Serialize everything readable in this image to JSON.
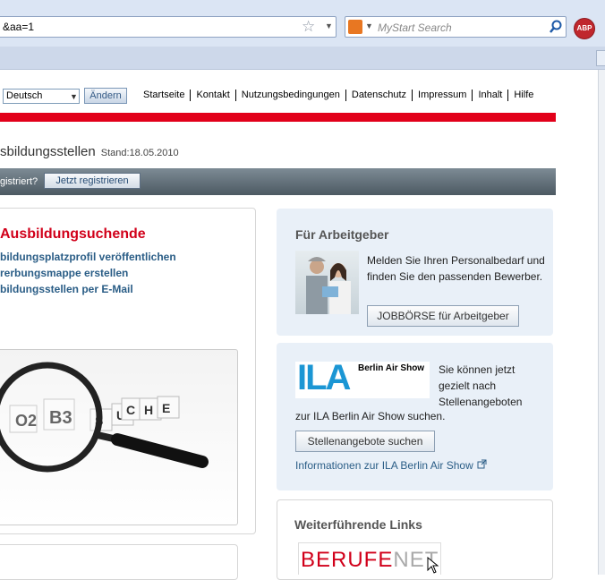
{
  "browser": {
    "url": "&aa=1",
    "search_placeholder": "MyStart Search",
    "adblock_label": "ABP",
    "icons": [
      "star-icon",
      "dropdown-icon",
      "search-engine-icon",
      "magnifier-icon",
      "adblock-icon"
    ]
  },
  "header": {
    "language_value": "Deutsch",
    "change_label": "Ändern",
    "nav": [
      "Startseite",
      "Kontakt",
      "Nutzungsbedingungen",
      "Datenschutz",
      "Impressum",
      "Inhalt",
      "Hilfe"
    ],
    "accent_color": "#e2001a"
  },
  "page": {
    "title": "sbildungsstellen",
    "date": "Stand:18.05.2010"
  },
  "register_bar": {
    "text": "gistriert?",
    "button_label": "Jetzt registrieren"
  },
  "left_panel": {
    "heading": "Ausbildungsuchende",
    "links": [
      "bildungsplatzprofil veröffentlichen",
      "rerbungsmappe erstellen",
      "bildungsstellen per E-Mail"
    ],
    "image_letters": [
      "O2",
      "B3",
      "S",
      "U",
      "C",
      "H",
      "E"
    ]
  },
  "employer_box": {
    "heading": "Für Arbeitgeber",
    "text": "Melden Sie Ihren Personalbedarf und finden Sie den passenden Bewerber.",
    "button_label": "JOBBÖRSE für Arbeitgeber"
  },
  "ila_box": {
    "logo_text": "ILA",
    "logo_subtext": "Berlin Air Show",
    "text_1": "Sie können jetzt gezielt nach Stellenangeboten",
    "text_2": "zur ILA Berlin Air Show suchen.",
    "button_label": "Stellenangebote suchen",
    "link_label": "Informationen zur ILA Berlin Air Show"
  },
  "links_box": {
    "heading": "Weiterführende Links",
    "logo_part_1": "BERUFE",
    "logo_part_2": "NET"
  }
}
